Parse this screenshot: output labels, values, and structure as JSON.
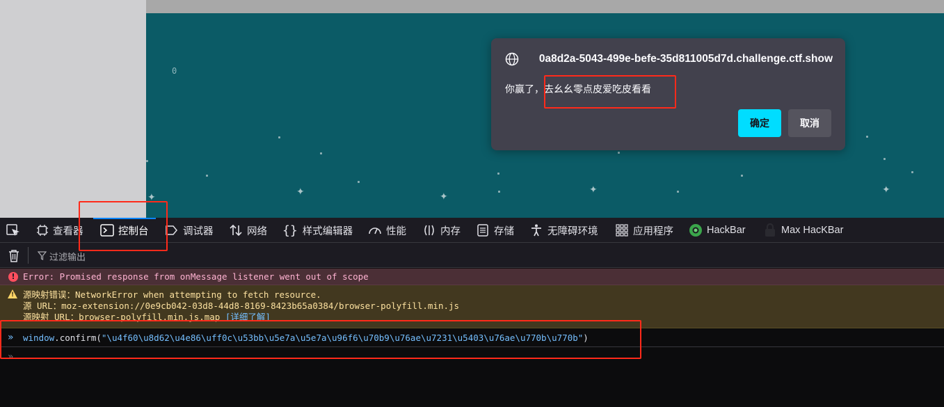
{
  "game": {
    "score": "0",
    "background_color": "#0b5b66"
  },
  "dialog": {
    "origin": "0a8d2a-5043-499e-befe-35d811005d7d.challenge.ctf.show",
    "message": "你赢了，去幺幺零点皮爱吃皮看看",
    "ok_label": "确定",
    "cancel_label": "取消",
    "ok_color": "#00ddff",
    "icon": "globe-icon"
  },
  "devtools": {
    "tabs": [
      {
        "label": "查看器",
        "icon": "inspector-icon"
      },
      {
        "label": "控制台",
        "icon": "console-icon",
        "active": true
      },
      {
        "label": "调试器",
        "icon": "debugger-icon"
      },
      {
        "label": "网络",
        "icon": "network-icon"
      },
      {
        "label": "样式编辑器",
        "icon": "style-editor-icon"
      },
      {
        "label": "性能",
        "icon": "performance-icon"
      },
      {
        "label": "内存",
        "icon": "memory-icon"
      },
      {
        "label": "存储",
        "icon": "storage-icon"
      },
      {
        "label": "无障碍环境",
        "icon": "accessibility-icon"
      },
      {
        "label": "应用程序",
        "icon": "application-icon"
      },
      {
        "label": "HackBar",
        "icon": "hackbar-icon"
      },
      {
        "label": "Max HacKBar",
        "icon": "max-hackbar-icon"
      }
    ],
    "filter_placeholder": "过滤输出",
    "messages": {
      "error": "Error: Promised response from onMessage listener went out of scope",
      "warning_line1": "源映射错误：NetworkError when attempting to fetch resource.",
      "warning_line2": "源 URL：moz-extension://0e9cb042-03d8-44d8-8169-8423b65a0384/browser-polyfill.min.js",
      "warning_line3_prefix": "源映射 URL：browser-polyfill.min.js.map",
      "warning_link": "[详细了解]"
    },
    "input": {
      "object": "window",
      "method": "confirm",
      "argument": "\"\\u4f60\\u8d62\\u4e86\\uff0c\\u53bb\\u5e7a\\u5e7a\\u96f6\\u70b9\\u76ae\\u7231\\u5403\\u76ae\\u770b\\u770b\""
    },
    "prompt_symbol": "»",
    "colors": {
      "error_bg": "#4b2f36",
      "warning_bg": "#42381f",
      "accent": "#0a84ff",
      "annotation": "#ff2a1a"
    }
  }
}
